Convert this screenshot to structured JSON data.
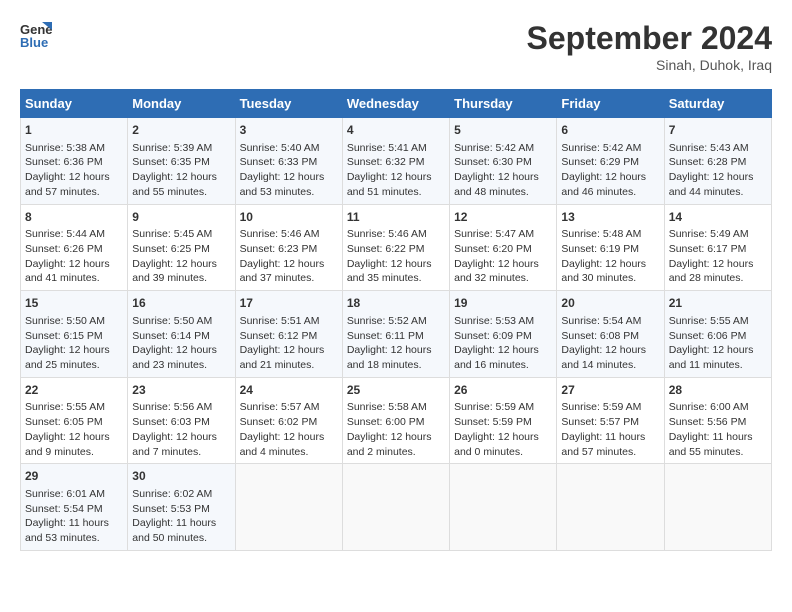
{
  "header": {
    "logo_line1": "General",
    "logo_line2": "Blue",
    "month": "September 2024",
    "location": "Sinah, Duhok, Iraq"
  },
  "weekdays": [
    "Sunday",
    "Monday",
    "Tuesday",
    "Wednesday",
    "Thursday",
    "Friday",
    "Saturday"
  ],
  "weeks": [
    [
      {
        "day": "1",
        "lines": [
          "Sunrise: 5:38 AM",
          "Sunset: 6:36 PM",
          "Daylight: 12 hours",
          "and 57 minutes."
        ]
      },
      {
        "day": "2",
        "lines": [
          "Sunrise: 5:39 AM",
          "Sunset: 6:35 PM",
          "Daylight: 12 hours",
          "and 55 minutes."
        ]
      },
      {
        "day": "3",
        "lines": [
          "Sunrise: 5:40 AM",
          "Sunset: 6:33 PM",
          "Daylight: 12 hours",
          "and 53 minutes."
        ]
      },
      {
        "day": "4",
        "lines": [
          "Sunrise: 5:41 AM",
          "Sunset: 6:32 PM",
          "Daylight: 12 hours",
          "and 51 minutes."
        ]
      },
      {
        "day": "5",
        "lines": [
          "Sunrise: 5:42 AM",
          "Sunset: 6:30 PM",
          "Daylight: 12 hours",
          "and 48 minutes."
        ]
      },
      {
        "day": "6",
        "lines": [
          "Sunrise: 5:42 AM",
          "Sunset: 6:29 PM",
          "Daylight: 12 hours",
          "and 46 minutes."
        ]
      },
      {
        "day": "7",
        "lines": [
          "Sunrise: 5:43 AM",
          "Sunset: 6:28 PM",
          "Daylight: 12 hours",
          "and 44 minutes."
        ]
      }
    ],
    [
      {
        "day": "8",
        "lines": [
          "Sunrise: 5:44 AM",
          "Sunset: 6:26 PM",
          "Daylight: 12 hours",
          "and 41 minutes."
        ]
      },
      {
        "day": "9",
        "lines": [
          "Sunrise: 5:45 AM",
          "Sunset: 6:25 PM",
          "Daylight: 12 hours",
          "and 39 minutes."
        ]
      },
      {
        "day": "10",
        "lines": [
          "Sunrise: 5:46 AM",
          "Sunset: 6:23 PM",
          "Daylight: 12 hours",
          "and 37 minutes."
        ]
      },
      {
        "day": "11",
        "lines": [
          "Sunrise: 5:46 AM",
          "Sunset: 6:22 PM",
          "Daylight: 12 hours",
          "and 35 minutes."
        ]
      },
      {
        "day": "12",
        "lines": [
          "Sunrise: 5:47 AM",
          "Sunset: 6:20 PM",
          "Daylight: 12 hours",
          "and 32 minutes."
        ]
      },
      {
        "day": "13",
        "lines": [
          "Sunrise: 5:48 AM",
          "Sunset: 6:19 PM",
          "Daylight: 12 hours",
          "and 30 minutes."
        ]
      },
      {
        "day": "14",
        "lines": [
          "Sunrise: 5:49 AM",
          "Sunset: 6:17 PM",
          "Daylight: 12 hours",
          "and 28 minutes."
        ]
      }
    ],
    [
      {
        "day": "15",
        "lines": [
          "Sunrise: 5:50 AM",
          "Sunset: 6:15 PM",
          "Daylight: 12 hours",
          "and 25 minutes."
        ]
      },
      {
        "day": "16",
        "lines": [
          "Sunrise: 5:50 AM",
          "Sunset: 6:14 PM",
          "Daylight: 12 hours",
          "and 23 minutes."
        ]
      },
      {
        "day": "17",
        "lines": [
          "Sunrise: 5:51 AM",
          "Sunset: 6:12 PM",
          "Daylight: 12 hours",
          "and 21 minutes."
        ]
      },
      {
        "day": "18",
        "lines": [
          "Sunrise: 5:52 AM",
          "Sunset: 6:11 PM",
          "Daylight: 12 hours",
          "and 18 minutes."
        ]
      },
      {
        "day": "19",
        "lines": [
          "Sunrise: 5:53 AM",
          "Sunset: 6:09 PM",
          "Daylight: 12 hours",
          "and 16 minutes."
        ]
      },
      {
        "day": "20",
        "lines": [
          "Sunrise: 5:54 AM",
          "Sunset: 6:08 PM",
          "Daylight: 12 hours",
          "and 14 minutes."
        ]
      },
      {
        "day": "21",
        "lines": [
          "Sunrise: 5:55 AM",
          "Sunset: 6:06 PM",
          "Daylight: 12 hours",
          "and 11 minutes."
        ]
      }
    ],
    [
      {
        "day": "22",
        "lines": [
          "Sunrise: 5:55 AM",
          "Sunset: 6:05 PM",
          "Daylight: 12 hours",
          "and 9 minutes."
        ]
      },
      {
        "day": "23",
        "lines": [
          "Sunrise: 5:56 AM",
          "Sunset: 6:03 PM",
          "Daylight: 12 hours",
          "and 7 minutes."
        ]
      },
      {
        "day": "24",
        "lines": [
          "Sunrise: 5:57 AM",
          "Sunset: 6:02 PM",
          "Daylight: 12 hours",
          "and 4 minutes."
        ]
      },
      {
        "day": "25",
        "lines": [
          "Sunrise: 5:58 AM",
          "Sunset: 6:00 PM",
          "Daylight: 12 hours",
          "and 2 minutes."
        ]
      },
      {
        "day": "26",
        "lines": [
          "Sunrise: 5:59 AM",
          "Sunset: 5:59 PM",
          "Daylight: 12 hours",
          "and 0 minutes."
        ]
      },
      {
        "day": "27",
        "lines": [
          "Sunrise: 5:59 AM",
          "Sunset: 5:57 PM",
          "Daylight: 11 hours",
          "and 57 minutes."
        ]
      },
      {
        "day": "28",
        "lines": [
          "Sunrise: 6:00 AM",
          "Sunset: 5:56 PM",
          "Daylight: 11 hours",
          "and 55 minutes."
        ]
      }
    ],
    [
      {
        "day": "29",
        "lines": [
          "Sunrise: 6:01 AM",
          "Sunset: 5:54 PM",
          "Daylight: 11 hours",
          "and 53 minutes."
        ]
      },
      {
        "day": "30",
        "lines": [
          "Sunrise: 6:02 AM",
          "Sunset: 5:53 PM",
          "Daylight: 11 hours",
          "and 50 minutes."
        ]
      },
      {
        "day": "",
        "lines": []
      },
      {
        "day": "",
        "lines": []
      },
      {
        "day": "",
        "lines": []
      },
      {
        "day": "",
        "lines": []
      },
      {
        "day": "",
        "lines": []
      }
    ]
  ]
}
